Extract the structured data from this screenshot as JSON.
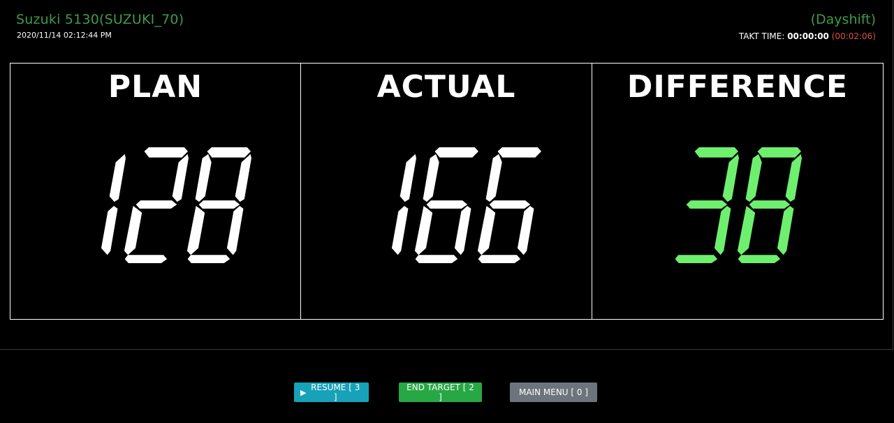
{
  "header": {
    "machine_title": "Suzuki 5130(SUZUKI_70)",
    "datetime": "2020/11/14 02:12:44 PM",
    "shift": "(Dayshift)",
    "takt_label": "TAKT TIME:",
    "takt_value": "00:00:00",
    "takt_over": "(00:02:06)"
  },
  "board": {
    "plan": {
      "label": "PLAN",
      "value": "128",
      "color": "#ffffff"
    },
    "actual": {
      "label": "ACTUAL",
      "value": "166",
      "color": "#ffffff"
    },
    "difference": {
      "label": "DIFFERENCE",
      "value": "38",
      "color": "#6ef06e"
    }
  },
  "buttons": {
    "resume_icon": "play-icon",
    "resume_label": "RESUME [ 3 ]",
    "end_target_label": "END TARGET [ 2 ]",
    "main_menu_label": "MAIN MENU [ 0 ]"
  },
  "colors": {
    "title_green": "#3f9b4b",
    "takt_over_red": "#d9534f",
    "resume_bg": "#17a2b8",
    "end_target_bg": "#28a745",
    "main_menu_bg": "#6c757d"
  }
}
